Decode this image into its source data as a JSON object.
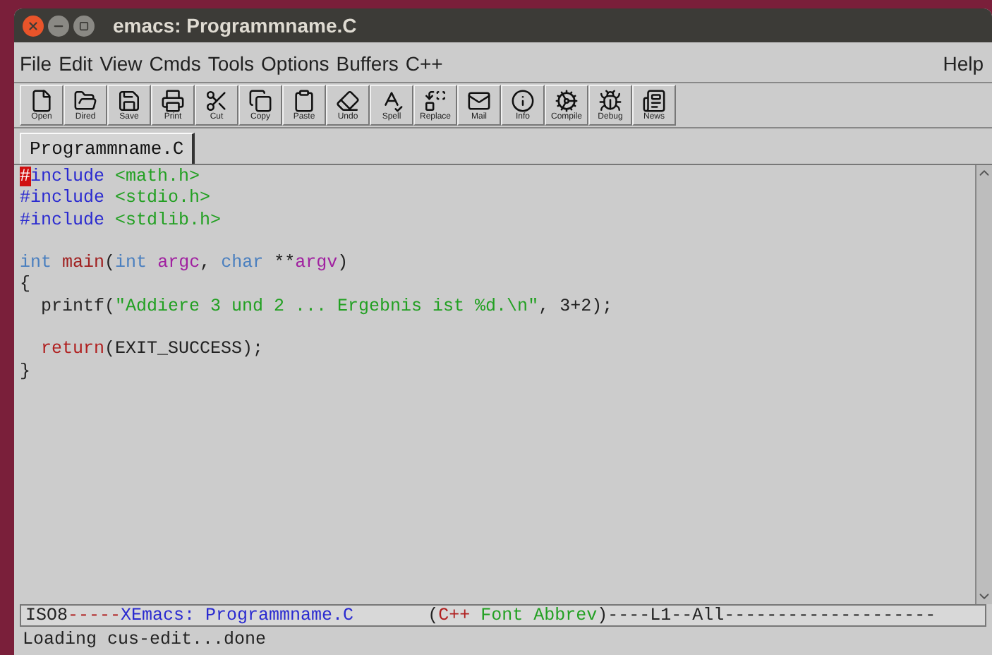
{
  "window": {
    "title": "emacs: Programmname.C"
  },
  "menu": {
    "items": [
      "File",
      "Edit",
      "View",
      "Cmds",
      "Tools",
      "Options",
      "Buffers",
      "C++"
    ],
    "help": "Help"
  },
  "toolbar": [
    {
      "label": "Open",
      "kind": "open"
    },
    {
      "label": "Dired",
      "kind": "dired"
    },
    {
      "label": "Save",
      "kind": "save"
    },
    {
      "label": "Print",
      "kind": "print"
    },
    {
      "label": "Cut",
      "kind": "cut"
    },
    {
      "label": "Copy",
      "kind": "copy"
    },
    {
      "label": "Paste",
      "kind": "paste"
    },
    {
      "label": "Undo",
      "kind": "undo"
    },
    {
      "label": "Spell",
      "kind": "spell"
    },
    {
      "label": "Replace",
      "kind": "replace"
    },
    {
      "label": "Mail",
      "kind": "mail"
    },
    {
      "label": "Info",
      "kind": "info"
    },
    {
      "label": "Compile",
      "kind": "compile"
    },
    {
      "label": "Debug",
      "kind": "debug"
    },
    {
      "label": "News",
      "kind": "news"
    }
  ],
  "tabs": [
    {
      "label": "Programmname.C",
      "selected": true
    }
  ],
  "editor": {
    "lines": [
      {
        "kind": "code",
        "tokens": [
          {
            "text": "#",
            "kind": "cursor"
          },
          {
            "text": "include",
            "kind": "preprocessor"
          },
          {
            "text": " <math.h>",
            "kind": "string"
          }
        ]
      },
      {
        "kind": "code",
        "tokens": [
          {
            "text": "#include",
            "kind": "preprocessor"
          },
          {
            "text": " <stdio.h>",
            "kind": "string"
          }
        ]
      },
      {
        "kind": "code",
        "tokens": [
          {
            "text": "#include",
            "kind": "preprocessor"
          },
          {
            "text": " <stdlib.h>",
            "kind": "string"
          }
        ]
      },
      {
        "kind": "blank"
      },
      {
        "kind": "code",
        "tokens": [
          {
            "text": "int",
            "kind": "type"
          },
          {
            "text": " main",
            "kind": "function"
          },
          {
            "text": "(",
            "kind": "plain"
          },
          {
            "text": "int",
            "kind": "type"
          },
          {
            "text": " argc",
            "kind": "variable"
          },
          {
            "text": ", ",
            "kind": "plain"
          },
          {
            "text": "char",
            "kind": "type"
          },
          {
            "text": " **",
            "kind": "plain"
          },
          {
            "text": "argv",
            "kind": "variable"
          },
          {
            "text": ")",
            "kind": "plain"
          }
        ]
      },
      {
        "kind": "code",
        "tokens": [
          {
            "text": "{",
            "kind": "plain"
          }
        ]
      },
      {
        "kind": "code",
        "tokens": [
          {
            "text": "  printf(",
            "kind": "plain"
          },
          {
            "text": "\"Addiere 3 und 2 ... Ergebnis ist %d.\\n\"",
            "kind": "string"
          },
          {
            "text": ", 3+2);",
            "kind": "plain"
          }
        ]
      },
      {
        "kind": "blank"
      },
      {
        "kind": "code",
        "tokens": [
          {
            "text": "  return",
            "kind": "keyword"
          },
          {
            "text": "(EXIT_SUCCESS);",
            "kind": "plain"
          }
        ]
      },
      {
        "kind": "code",
        "tokens": [
          {
            "text": "}",
            "kind": "plain"
          }
        ]
      }
    ]
  },
  "modeline": [
    {
      "text": "ISO8",
      "kind": "plain"
    },
    {
      "text": "-----",
      "kind": "keyword"
    },
    {
      "text": "XEmacs: Programmname.C",
      "kind": "preprocessor"
    },
    {
      "text": "       (",
      "kind": "plain"
    },
    {
      "text": "C++",
      "kind": "keyword"
    },
    {
      "text": " Font Abbrev",
      "kind": "string"
    },
    {
      "text": ")----L1--All--------------------",
      "kind": "plain"
    }
  ],
  "minibuffer": "Loading cus-edit...done"
}
